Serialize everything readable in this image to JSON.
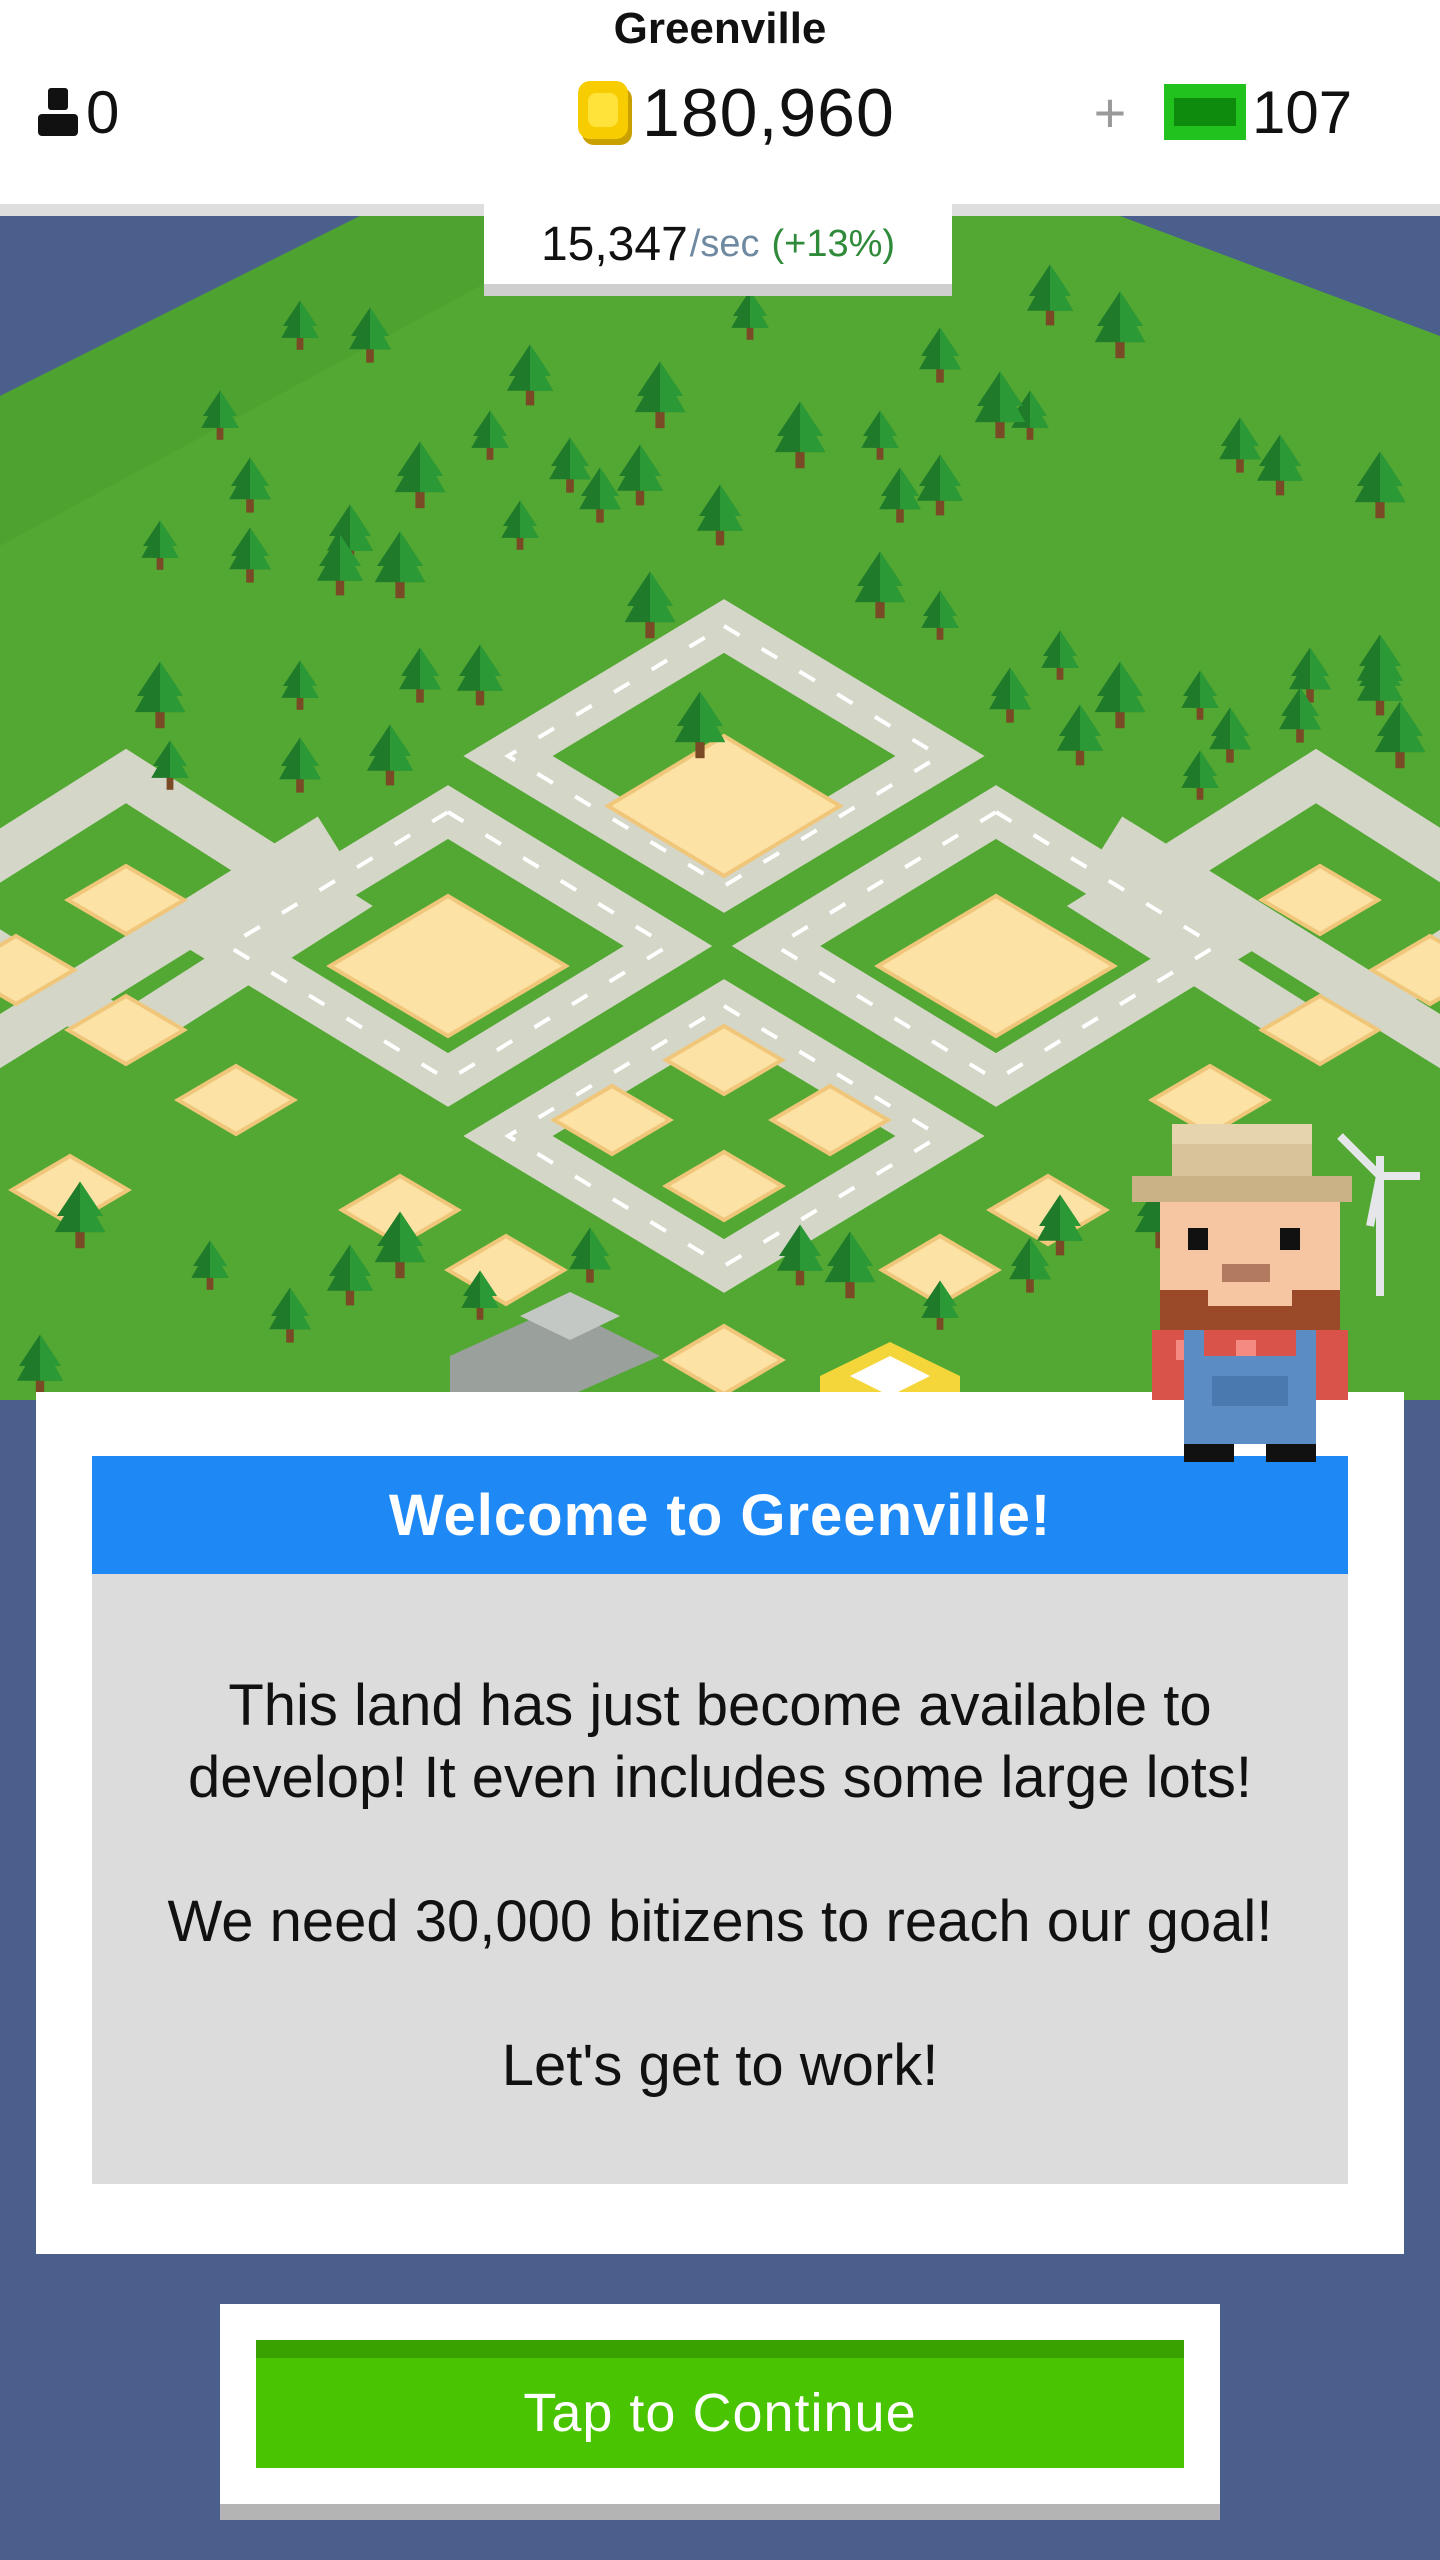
{
  "hud": {
    "city_name": "Greenville",
    "population": "0",
    "coins": "180,960",
    "add_cash_label": "+",
    "cash": "107",
    "rate_value": "15,347",
    "rate_unit": "/sec",
    "rate_bonus": "(+13%)"
  },
  "icons": {
    "population": "person-icon",
    "coins": "coin-icon",
    "cash": "cash-bill-icon",
    "add": "plus-icon"
  },
  "dialog": {
    "title": "Welcome to Greenville!",
    "line1": "This land has just become available to",
    "line2": "develop! It even includes some large lots!",
    "line3": "We need 30,000 bitizens to reach our goal!",
    "line4": "Let's get to work!"
  },
  "continue_button": {
    "label": "Tap to Continue"
  },
  "colors": {
    "water": "#4a5f8c",
    "grass": "#52a832",
    "road": "#d4d6c8",
    "lot": "#fde2a6",
    "dialog_header": "#1e88f4",
    "continue_button": "#49c400"
  }
}
